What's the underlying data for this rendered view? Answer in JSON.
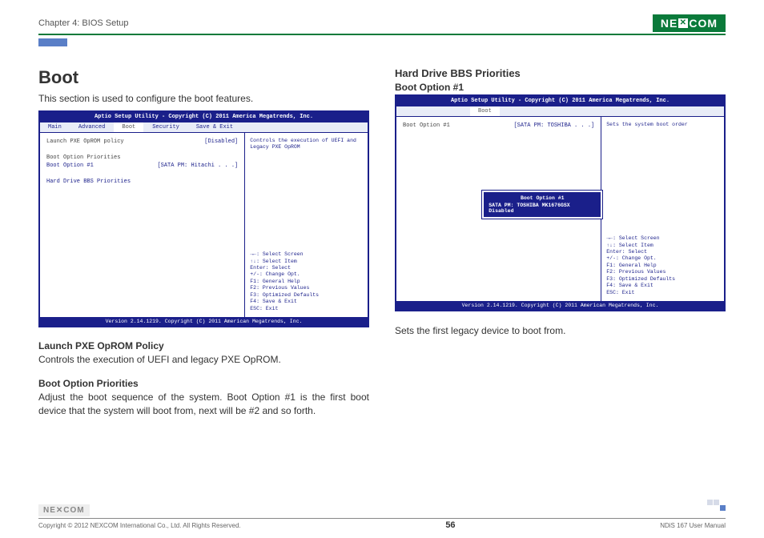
{
  "header": {
    "chapter": "Chapter 4: BIOS Setup",
    "logo_pre": "NE",
    "logo_post": "COM"
  },
  "left": {
    "h1": "Boot",
    "intro": "This section is used to configure the boot features.",
    "sub1_title": "Launch PXE OpROM Policy",
    "sub1_desc": "Controls the execution of UEFI and legacy PXE OpROM.",
    "sub2_title": "Boot Option Priorities",
    "sub2_desc": "Adjust the boot sequence of the system. Boot Option #1 is the first boot device that the system will boot from, next will be #2 and so forth."
  },
  "right": {
    "h2": "Hard Drive BBS Priorities",
    "h3": "Boot Option #1",
    "desc": "Sets the first legacy device to boot from."
  },
  "bios_common": {
    "title": "Aptio Setup Utility - Copyright (C) 2011 America Megatrends, Inc.",
    "footer": "Version 2.14.1219. Copyright (C) 2011 American Megatrends, Inc.",
    "tabs": [
      "Main",
      "Advanced",
      "Boot",
      "Security",
      "Save & Exit"
    ],
    "keys": [
      "→←: Select Screen",
      "↑↓: Select Item",
      "Enter: Select",
      "+/-: Change Opt.",
      "F1: General Help",
      "F2: Previous Values",
      "F3: Optimized Defaults",
      "F4: Save & Exit",
      "ESC: Exit"
    ]
  },
  "bios1": {
    "rows": [
      {
        "lbl": "Launch PXE OpROM policy",
        "val": "[Disabled]",
        "blue": false
      },
      {
        "lbl": "",
        "val": "",
        "blue": false
      },
      {
        "lbl": "Boot Option Priorities",
        "val": "",
        "blue": false
      },
      {
        "lbl": "Boot Option #1",
        "val": "[SATA PM: Hitachi . . .]",
        "blue": true
      },
      {
        "lbl": "",
        "val": "",
        "blue": false
      },
      {
        "lbl": "Hard Drive BBS Priorities",
        "val": "",
        "blue": true
      }
    ],
    "help": "Controls the execution of UEFI and Legacy PXE OpROM"
  },
  "bios2": {
    "rows": [
      {
        "lbl": "Boot Option #1",
        "val": "[SATA PM:   TOSHIBA . . .]",
        "blue": false
      }
    ],
    "help": "Sets the system boot order",
    "popup": {
      "title": "Boot Option #1",
      "line1": "SATA PM: TOSHIBA MK1676GSX",
      "line2": "Disabled"
    }
  },
  "footer": {
    "copyright": "Copyright © 2012 NEXCOM International Co., Ltd. All Rights Reserved.",
    "page": "56",
    "manual": "NDiS 167 User Manual"
  }
}
